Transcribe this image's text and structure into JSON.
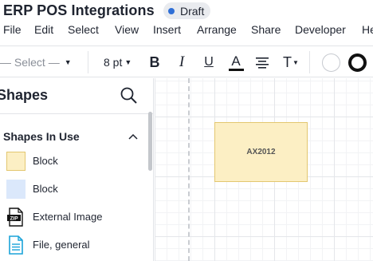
{
  "document": {
    "title": "ERP POS Integrations",
    "status": "Draft",
    "status_color": "#2f6fd6"
  },
  "menu": [
    "File",
    "Edit",
    "Select",
    "View",
    "Insert",
    "Arrange",
    "Share",
    "Developer",
    "He"
  ],
  "toolbar": {
    "font_family": "— Select —",
    "font_size": "8 pt",
    "bold": "B",
    "italic": "I",
    "underline": "U",
    "text_color_glyph": "A",
    "text_style_glyph": "T",
    "fill_color": "#ffffff",
    "line_color": "#111111"
  },
  "panel": {
    "title": "Shapes",
    "section": "Shapes In Use",
    "items": [
      {
        "label": "Block",
        "icon": "block-yellow-icon"
      },
      {
        "label": "Block",
        "icon": "block-blue-icon"
      },
      {
        "label": "External Image",
        "icon": "zip-file-icon"
      },
      {
        "label": "File, general",
        "icon": "file-general-icon"
      }
    ]
  },
  "canvas": {
    "blocks": [
      {
        "label": "AX2012",
        "fill": "#fcefc4",
        "border": "#e3c770"
      }
    ]
  }
}
